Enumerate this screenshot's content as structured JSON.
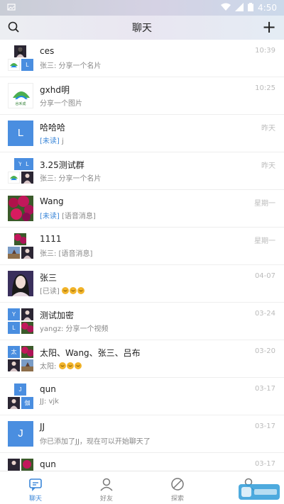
{
  "status_bar": {
    "time": "4:50"
  },
  "header": {
    "title": "聊天"
  },
  "conversations": [
    {
      "name": "ces",
      "preview": "张三: 分享一个名片",
      "time": "10:39"
    },
    {
      "name": "gxhd明",
      "preview": "分享一个图片",
      "time": "10:25",
      "logo_text": "谷禾成"
    },
    {
      "name": "哈哈哈",
      "unread_tag": "[未读]",
      "preview": " j",
      "time": "昨天",
      "avatar_letter": "L"
    },
    {
      "name": "3.25测试群",
      "preview": "张三: 分享一个名片",
      "time": "昨天",
      "tiles": [
        "Y",
        "L"
      ]
    },
    {
      "name": "Wang",
      "unread_tag": "[未读]",
      "preview": " [语音消息]",
      "time": "星期一"
    },
    {
      "name": "1111",
      "preview": "张三: [语音消息]",
      "time": "星期一"
    },
    {
      "name": "张三",
      "unread_tag": "[已读]",
      "preview": "",
      "time": "04-07"
    },
    {
      "name": "测试加密",
      "preview": "yangz: 分享一个视频",
      "time": "03-24",
      "tiles": [
        "Y",
        "L"
      ]
    },
    {
      "name": "太阳、Wang、张三、吕布",
      "preview": "太阳: ",
      "time": "03-20",
      "tiles": [
        "太"
      ]
    },
    {
      "name": "qun",
      "preview": "JJ: vjk",
      "time": "03-17",
      "tiles": [
        "J",
        "伽"
      ]
    },
    {
      "name": "JJ",
      "preview": "你已添加了JJ，现在可以开始聊天了",
      "time": "03-17",
      "avatar_letter": "J"
    },
    {
      "name": "qun",
      "preview": "",
      "time": "03-17"
    }
  ],
  "tabs": [
    {
      "label": "聊天",
      "icon": "chat-icon",
      "active": true
    },
    {
      "label": "好友",
      "icon": "friends-icon",
      "active": false
    },
    {
      "label": "探索",
      "icon": "explore-icon",
      "active": false
    },
    {
      "label": "",
      "icon": "me-icon",
      "active": false
    }
  ],
  "colors": {
    "accent": "#3a86d8",
    "letter_avatar": "#4a8ee0",
    "time": "#bbbbbb"
  }
}
